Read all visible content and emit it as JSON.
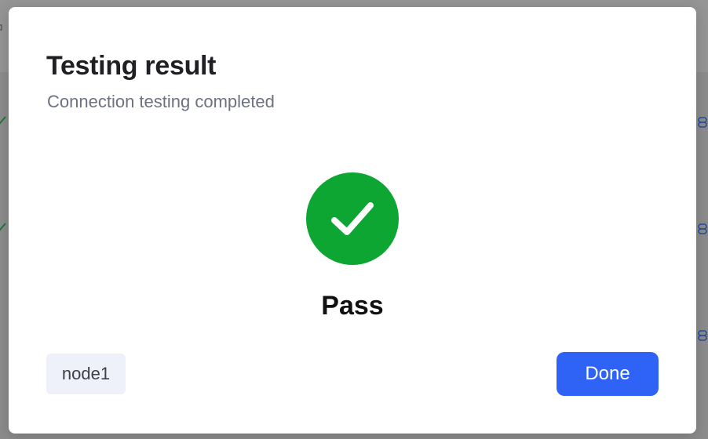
{
  "dialog": {
    "title": "Testing result",
    "subtitle": "Connection testing completed",
    "result": {
      "status": "Pass",
      "icon": "check-circle-icon",
      "color": "#0ea632"
    },
    "node": "node1",
    "done_label": "Done"
  },
  "colors": {
    "accent": "#2f63f6",
    "success": "#0ea632",
    "chip_bg": "#eef0fa",
    "backdrop_link": "#2a4f9a",
    "backdrop_check": "#1f7a3a"
  }
}
